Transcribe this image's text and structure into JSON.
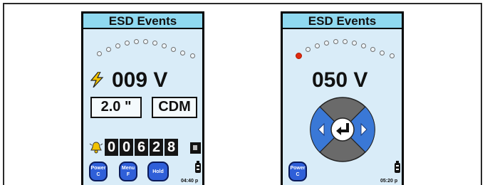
{
  "left_device": {
    "title": "ESD Events",
    "voltage": "009 V",
    "distance": "2.0 \"",
    "mode": "CDM",
    "counter_digits": [
      "0",
      "0",
      "6",
      "2",
      "8"
    ],
    "softkeys": [
      {
        "top": "Power",
        "bottom": "C"
      },
      {
        "top": "Menu",
        "bottom": "F"
      },
      {
        "label": "Hold"
      }
    ],
    "time": "04:40 p",
    "event_dots": 11,
    "icons": [
      "lightning-icon",
      "bell-icon",
      "reset-icon",
      "battery-icon"
    ]
  },
  "right_device": {
    "title": "ESD Events",
    "voltage": "050 V",
    "softkeys": [
      {
        "top": "Power",
        "bottom": "C"
      }
    ],
    "time": "05:20 p",
    "event_dots": 11,
    "active_dot_index": 0,
    "icons": [
      "left-arrow-icon",
      "right-arrow-icon",
      "enter-icon",
      "battery-icon"
    ]
  },
  "colors": {
    "screen": "#d9ecf8",
    "titlebar": "#8fd9f0",
    "softkey": "#2f5fd8",
    "dpad_blue": "#3a78d6",
    "dpad_gray": "#6a6a6a",
    "active_dot": "#e02a10"
  }
}
